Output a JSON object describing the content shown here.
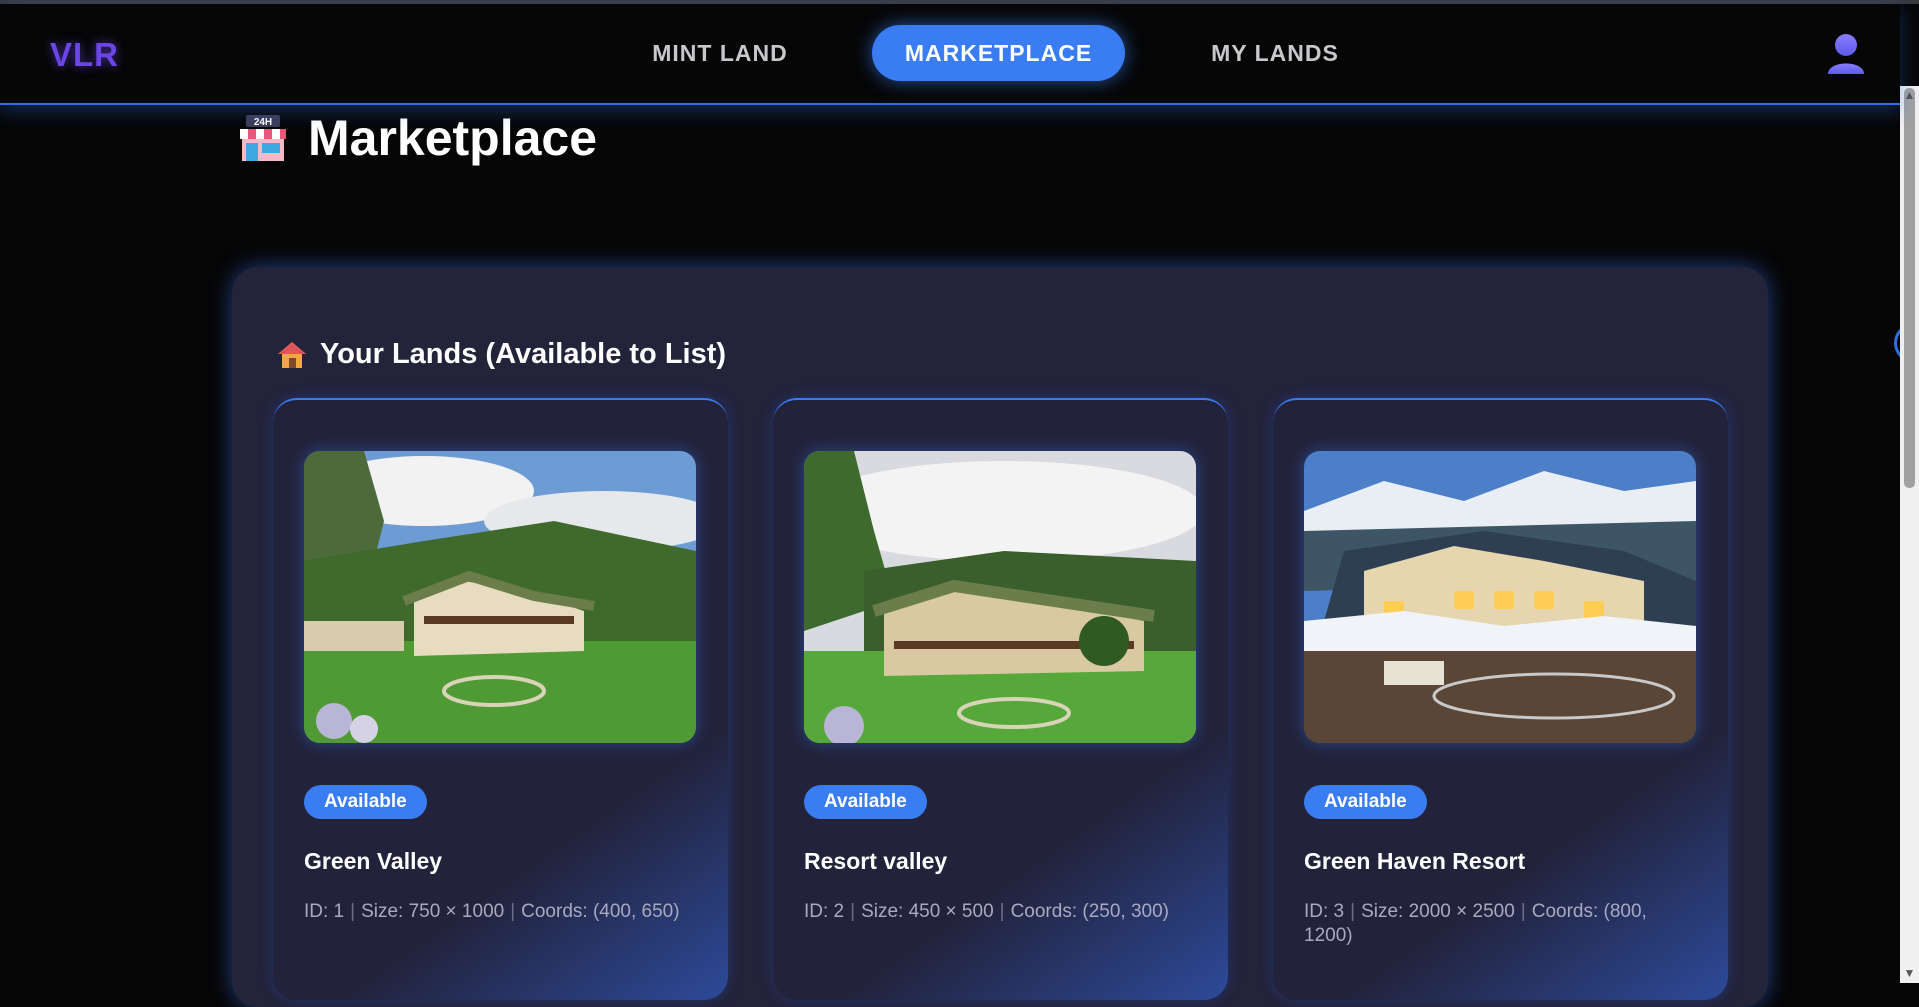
{
  "app": {
    "logo": "VLR"
  },
  "nav": {
    "items": [
      {
        "label": "MINT LAND"
      },
      {
        "label": "MARKETPLACE",
        "active": true
      },
      {
        "label": "MY LANDS"
      }
    ]
  },
  "page": {
    "title": "Marketplace",
    "icon": "store-24h-icon"
  },
  "section": {
    "title": "Your Lands (Available to List)",
    "icon": "house-icon"
  },
  "lands": [
    {
      "status": "Available",
      "name": "Green Valley",
      "id": "ID: 1",
      "size": "Size: 750 × 1000",
      "coords": "Coords: (400, 650)"
    },
    {
      "status": "Available",
      "name": "Resort valley",
      "id": "ID: 2",
      "size": "Size: 450 × 500",
      "coords": "Coords: (250, 300)"
    },
    {
      "status": "Available",
      "name": "Green Haven Resort",
      "id": "ID: 3",
      "size": "Size: 2000 × 2500",
      "coords": "Coords: (800, 1200)"
    }
  ],
  "colors": {
    "accent": "#3a7df2",
    "logo": "#6b46e6",
    "panel": "#23233a",
    "background": "#060607"
  },
  "scrollbar": {
    "up_arrow": "▲",
    "down_arrow": "▼"
  }
}
